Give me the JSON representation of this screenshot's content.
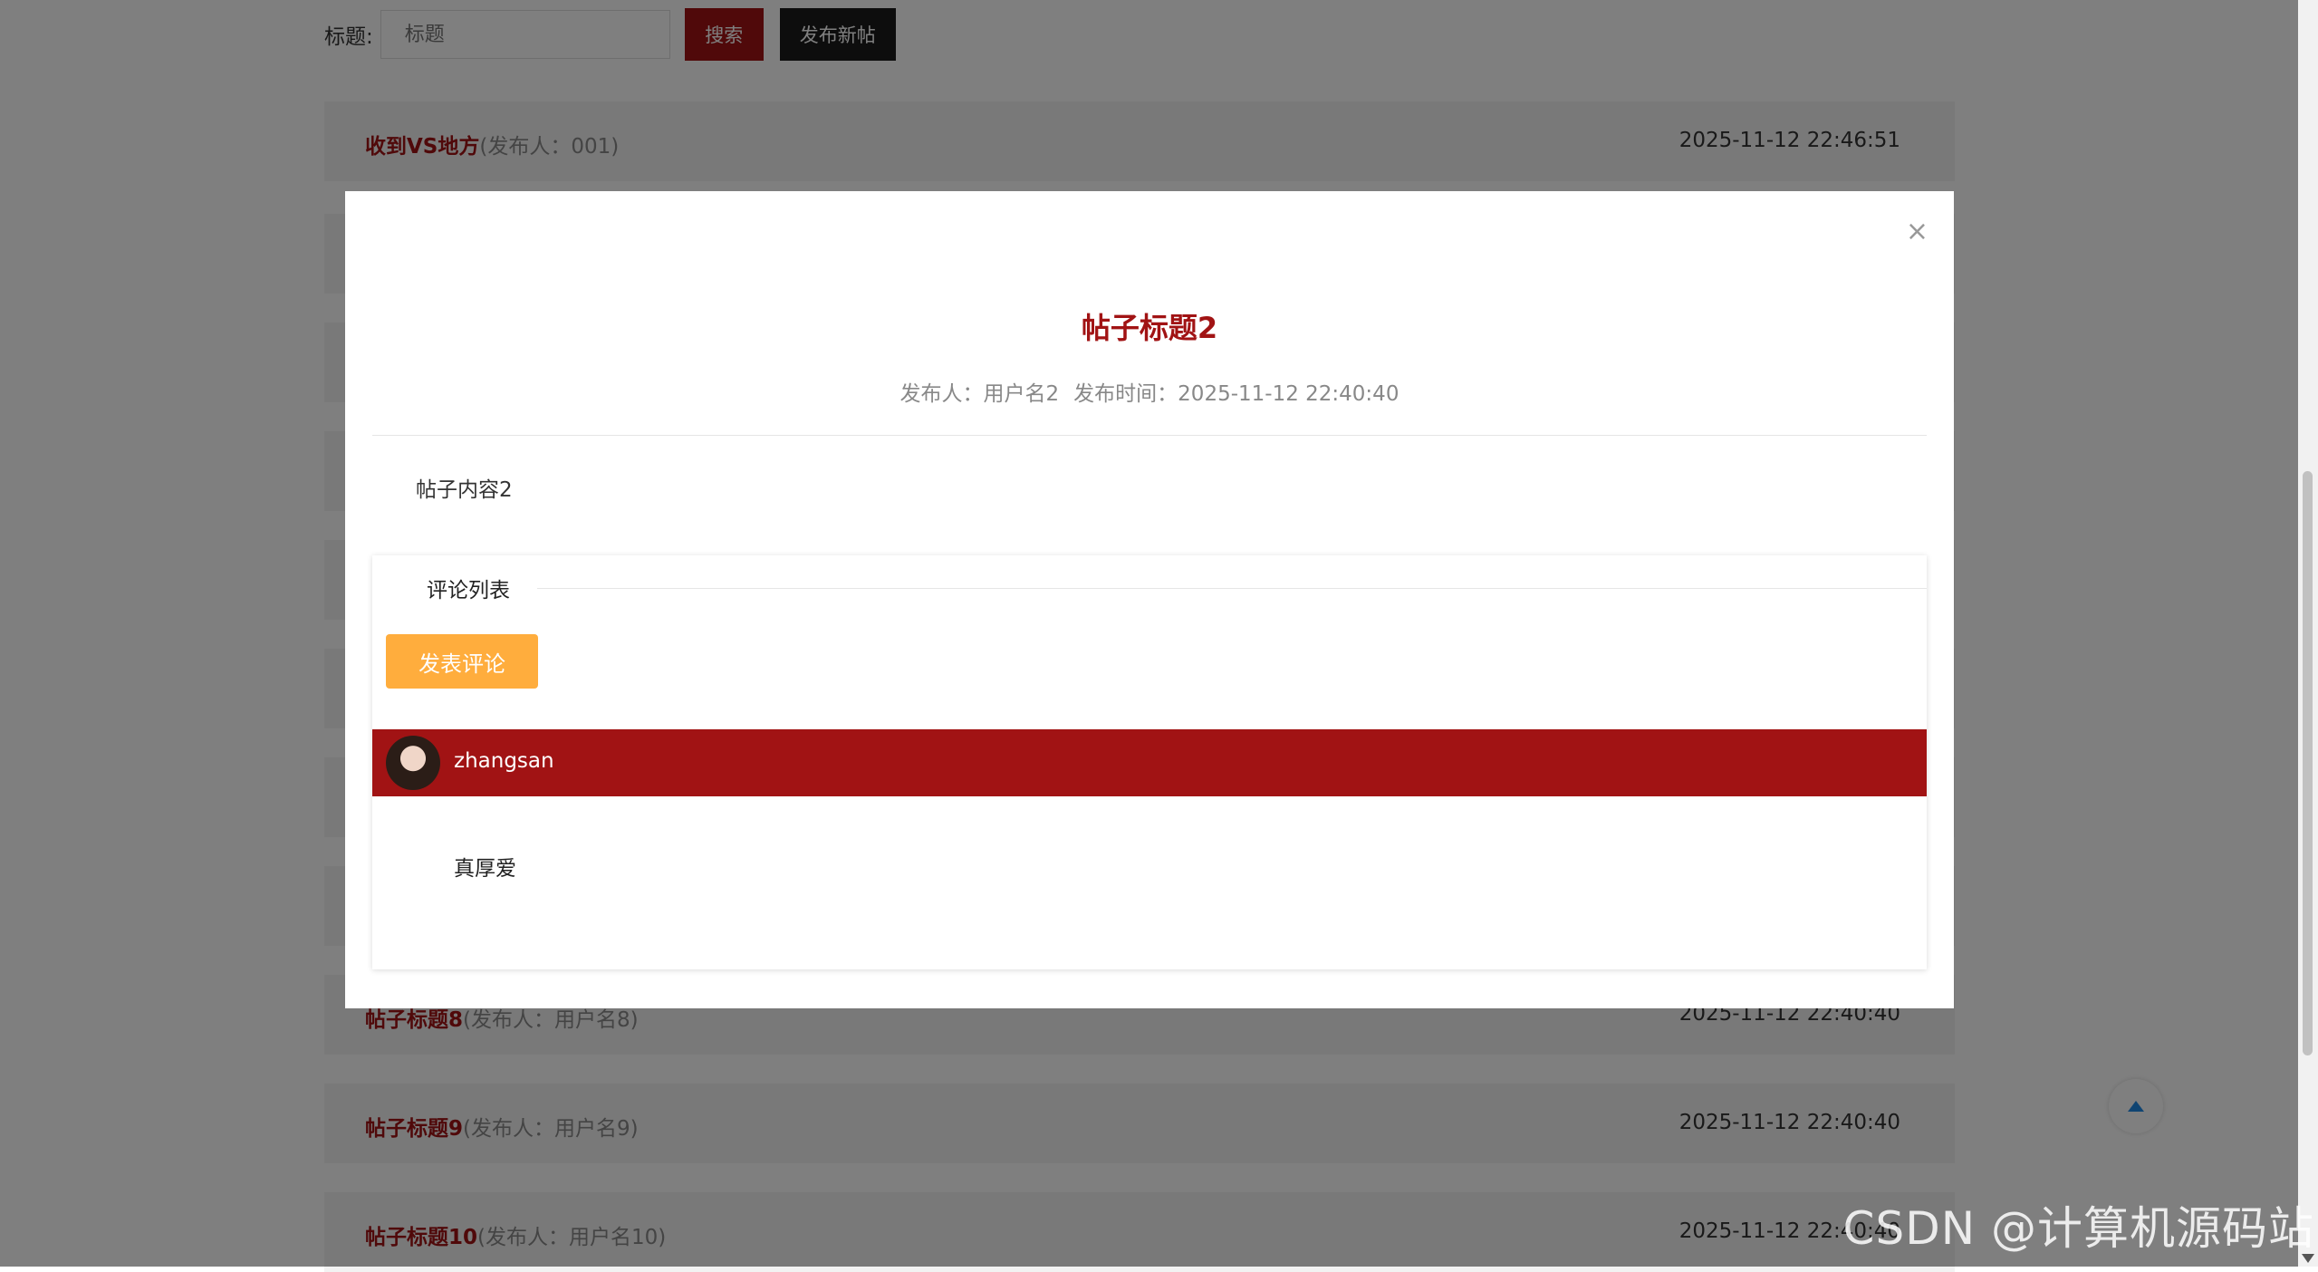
{
  "search": {
    "label": "标题:",
    "placeholder": "标题",
    "search_button": "搜索",
    "new_post_button": "发布新帖"
  },
  "posts": [
    {
      "title": "收到VS地方",
      "author": "(发布人：001)",
      "time": "2025-11-12 22:46:51"
    },
    {
      "title": "帖子标题8",
      "author": "(发布人：用户名8)",
      "time": "2025-11-12 22:40:40"
    },
    {
      "title": "帖子标题9",
      "author": "(发布人：用户名9)",
      "time": "2025-11-12 22:40:40"
    },
    {
      "title": "帖子标题10",
      "author": "(发布人：用户名10)",
      "time": "2025-11-12 22:40:40"
    }
  ],
  "modal": {
    "close": "×",
    "title": "帖子标题2",
    "publisher": "发布人：用户名2",
    "publish_time": "发布时间：2025-11-12 22:40:40",
    "content": "帖子内容2",
    "comments": {
      "legend": "评论列表",
      "add_button": "发表评论",
      "items": [
        {
          "user": "zhangsan",
          "text": "真厚爱"
        }
      ]
    }
  },
  "watermark": "CSDN @计算机源码站",
  "colors": {
    "brand": "#a11314",
    "accent": "#ffad3d",
    "dark_button": "#1a1a1a",
    "back_top_arrow": "#1e88e5"
  },
  "icons": {
    "close": "close-icon",
    "back_to_top": "arrow-up-icon",
    "avatar": "user-avatar"
  }
}
